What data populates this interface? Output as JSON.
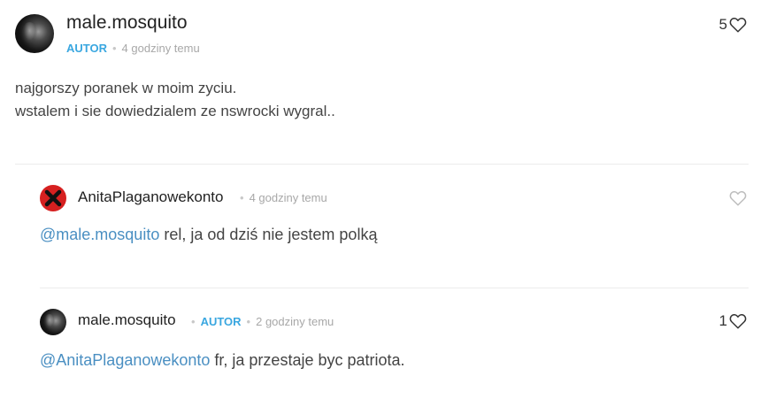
{
  "post": {
    "username": "male.mosquito",
    "badge": "AUTOR",
    "time": "4 godziny temu",
    "likes": "5",
    "lines": [
      "najgorszy poranek w moim zyciu.",
      "wstalem i sie dowiedzialem ze nswrocki wygral.."
    ]
  },
  "replies": [
    {
      "username": "AnitaPlaganowekonto",
      "time": "4 godziny temu",
      "mention": "@male.mosquito",
      "text": " rel, ja od dziś nie jestem polką",
      "likes": ""
    },
    {
      "username": "male.mosquito",
      "badge": "AUTOR",
      "time": "2 godziny temu",
      "mention": "@AnitaPlaganowekonto",
      "text": " fr, ja przestaje byc patriota.",
      "likes": "1"
    }
  ],
  "meta_separator": "•",
  "colors": {
    "accent_badge": "#3aa7e0",
    "mention": "#4a8fc2",
    "meta_gray": "#a8a8a8"
  },
  "icons": {
    "like": "heart-outline-icon",
    "avatar_error": "x-mark-icon"
  }
}
